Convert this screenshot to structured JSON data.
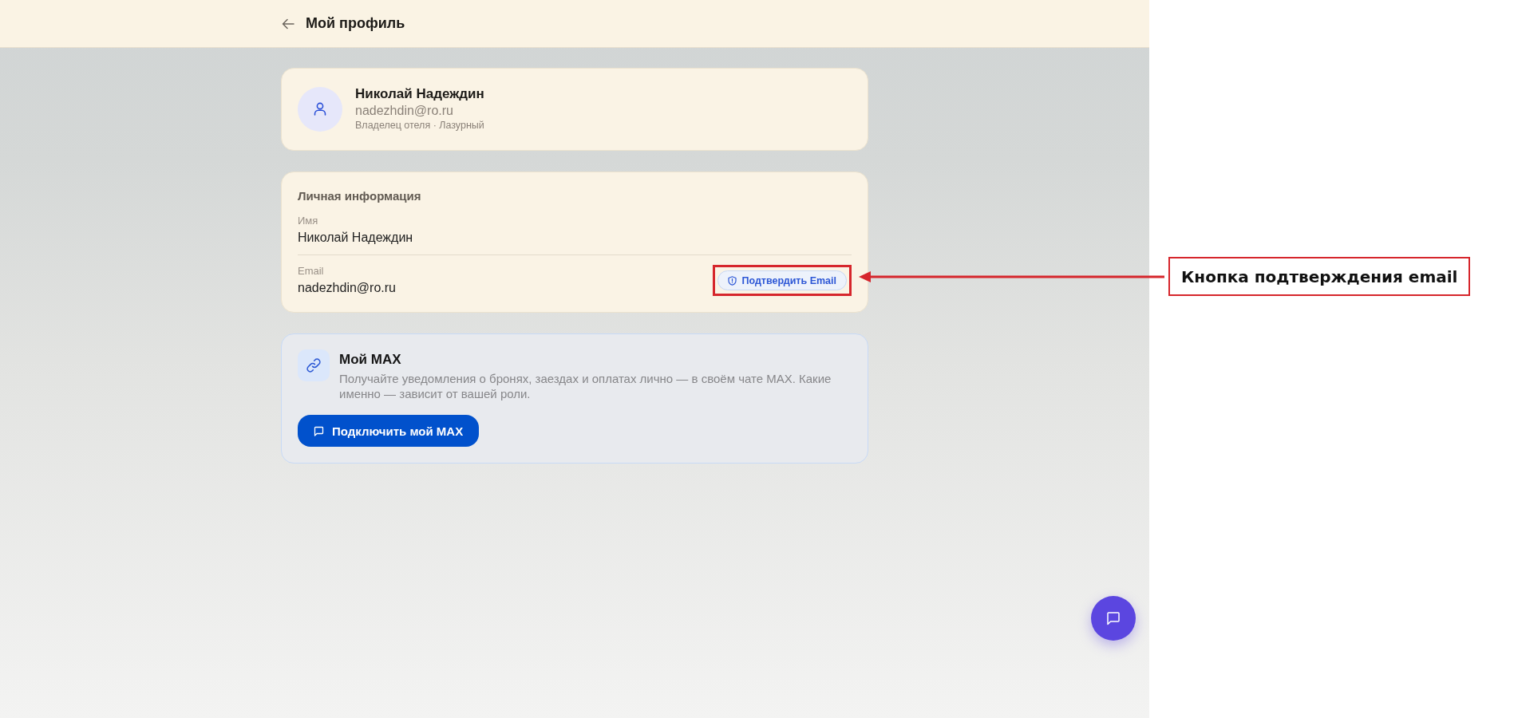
{
  "header": {
    "title": "Мой профиль"
  },
  "profile": {
    "name": "Николай Надеждин",
    "email": "nadezhdin@ro.ru",
    "role": "Владелец отеля · Лазурный"
  },
  "personal_info": {
    "title": "Личная информация",
    "fields": [
      {
        "label": "Имя",
        "value": "Николай Надеждин"
      },
      {
        "label": "Email",
        "value": "nadezhdin@ro.ru",
        "action": {
          "label": "Подтвердить Email",
          "highlighted": true
        }
      }
    ]
  },
  "max": {
    "title": "Мой MAX",
    "description": "Получайте уведомления о бронях, заездах и оплатах лично — в своём чате MAX. Какие именно — зависит от вашей роли.",
    "button": "Подключить мой MAX"
  },
  "annotation": {
    "label": "Кнопка подтверждения email"
  }
}
